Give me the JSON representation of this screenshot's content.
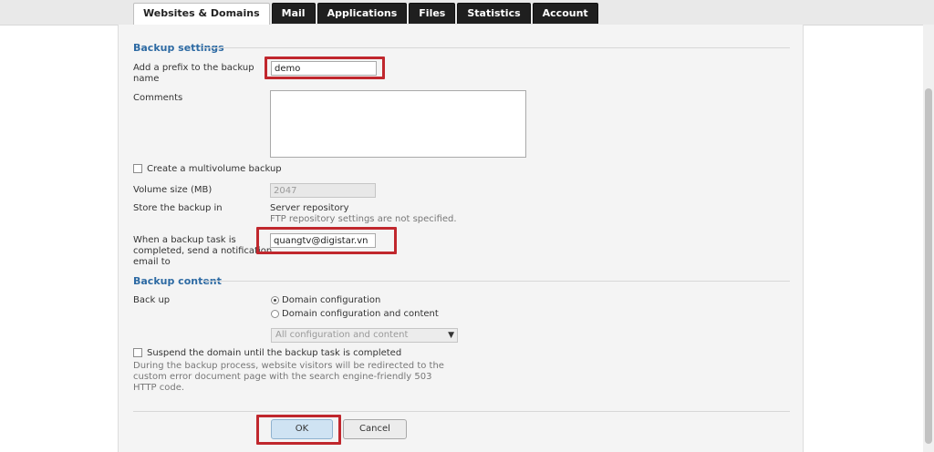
{
  "tabs": [
    {
      "label": "Websites & Domains",
      "active": true
    },
    {
      "label": "Mail",
      "active": false
    },
    {
      "label": "Applications",
      "active": false
    },
    {
      "label": "Files",
      "active": false
    },
    {
      "label": "Statistics",
      "active": false
    },
    {
      "label": "Account",
      "active": false
    }
  ],
  "backup_settings": {
    "title": "Backup settings",
    "prefix_label_line1": "Add a prefix to the backup",
    "prefix_label_line2": "name",
    "prefix_value": "demo",
    "comments_label": "Comments",
    "comments_value": "",
    "multivolume_label": "Create a multivolume backup",
    "volume_size_label": "Volume size (MB)",
    "volume_size_value": "2047",
    "store_label": "Store the backup in",
    "store_value": "Server repository",
    "store_hint": "FTP repository settings are not specified.",
    "notify_label_line1": "When a backup task is",
    "notify_label_line2": "completed, send a notification",
    "notify_label_line3": "email to",
    "notify_value": "quangtv@digistar.vn"
  },
  "backup_content": {
    "title": "Backup content",
    "backup_label": "Back up",
    "option_domain_config": "Domain configuration",
    "option_domain_config_content": "Domain configuration and content",
    "selected_option": "Domain configuration",
    "content_select_value": "All configuration and content",
    "suspend_label": "Suspend the domain until the backup task is completed",
    "suspend_hint_line1": "During the backup process, website visitors will be redirected to the",
    "suspend_hint_line2": "custom error document page with the search engine-friendly 503",
    "suspend_hint_line3": "HTTP code."
  },
  "buttons": {
    "ok_label": "OK",
    "cancel_label": "Cancel"
  },
  "colors": {
    "highlight": "#c0272d",
    "section_title": "#2d6aa3",
    "tab_dark": "#1f1f1f"
  }
}
